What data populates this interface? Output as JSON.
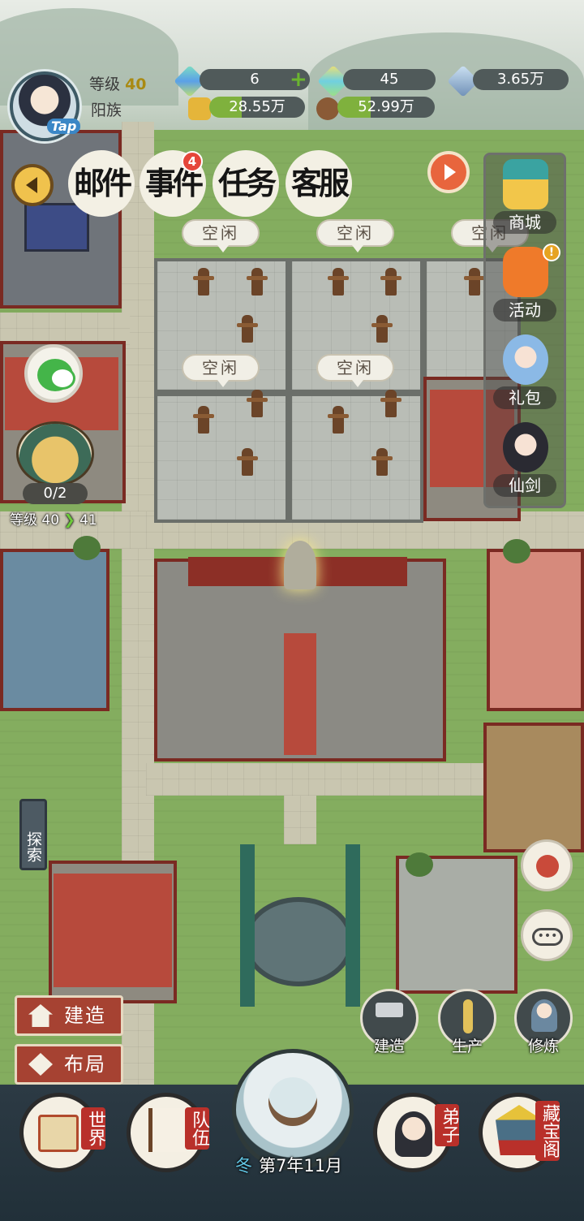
{
  "player": {
    "level_label": "等级",
    "level_value": "40",
    "clan": "阳族",
    "tap": "Tap"
  },
  "resources": {
    "jade_green": "6",
    "jade_rainbow": "45",
    "spirit_stone": "3.65万",
    "gold": "28.55万",
    "wood": "52.99万"
  },
  "boards": [
    {
      "label": "邮件"
    },
    {
      "label": "事件",
      "badge": "4"
    },
    {
      "label": "任务"
    },
    {
      "label": "客服"
    }
  ],
  "courtyard_bubbles": [
    "空闲",
    "空闲",
    "空闲",
    "空闲",
    "空闲"
  ],
  "side_menu": [
    {
      "label": "商城",
      "icon": "shop-pagoda-icon"
    },
    {
      "label": "活动",
      "icon": "lantern-icon",
      "alert": "!"
    },
    {
      "label": "礼包",
      "icon": "gift-girl-icon"
    },
    {
      "label": "仙剑",
      "icon": "sword-fairy-icon"
    }
  ],
  "sect": {
    "progress": "0/2",
    "level_from": "等级 40",
    "level_to": "41"
  },
  "explore_label": "探索",
  "build_buttons": [
    {
      "label": "建造",
      "icon": "house-icon"
    },
    {
      "label": "布局",
      "icon": "layout-icon"
    }
  ],
  "actions": [
    {
      "label": "建造",
      "icon": "hammer-icon"
    },
    {
      "label": "生产",
      "icon": "wheat-icon"
    },
    {
      "label": "修炼",
      "icon": "cultivator-icon"
    }
  ],
  "bottom_nav": [
    {
      "label": "世界",
      "icon": "world-scroll-icon"
    },
    {
      "label": "队伍",
      "icon": "team-flag-icon"
    },
    {
      "label": "弟子",
      "icon": "disciple-icon"
    },
    {
      "label": "藏宝阁",
      "icon": "treasure-pavilion-icon"
    }
  ],
  "calendar": {
    "season": "冬",
    "date": "第7年11月"
  },
  "colors": {
    "accent_red": "#b9302a",
    "hud_dark": "#505a5a",
    "badge_red": "#e5463a"
  }
}
